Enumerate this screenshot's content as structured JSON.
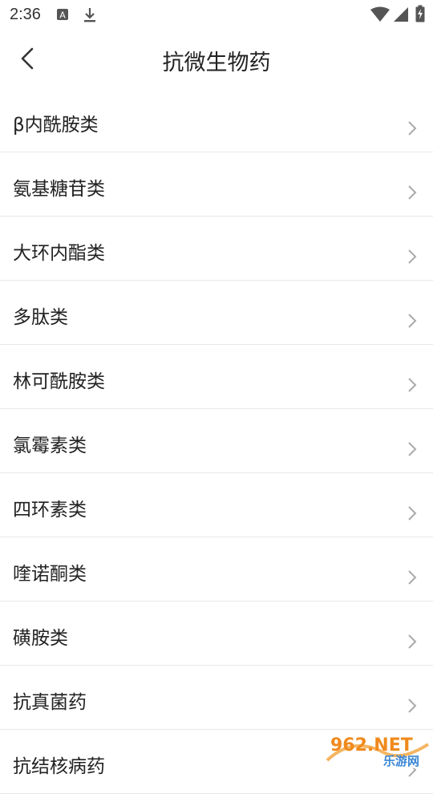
{
  "status_bar": {
    "time": "2:36",
    "icons": [
      "a-notification-icon",
      "download-icon",
      "wifi-icon",
      "signal-icon",
      "battery-charging-icon"
    ]
  },
  "header": {
    "title": "抗微生物药",
    "back_icon": "back-arrow-icon"
  },
  "list": {
    "items": [
      {
        "label": "β内酰胺类"
      },
      {
        "label": "氨基糖苷类"
      },
      {
        "label": "大环内酯类"
      },
      {
        "label": "多肽类"
      },
      {
        "label": "林可酰胺类"
      },
      {
        "label": "氯霉素类"
      },
      {
        "label": "四环素类"
      },
      {
        "label": "喹诺酮类"
      },
      {
        "label": "磺胺类"
      },
      {
        "label": "抗真菌药"
      },
      {
        "label": "抗结核病药"
      }
    ],
    "chevron_icon": "chevron-right-icon"
  },
  "watermark": {
    "brand": "962.NET",
    "sub": "乐游网"
  }
}
